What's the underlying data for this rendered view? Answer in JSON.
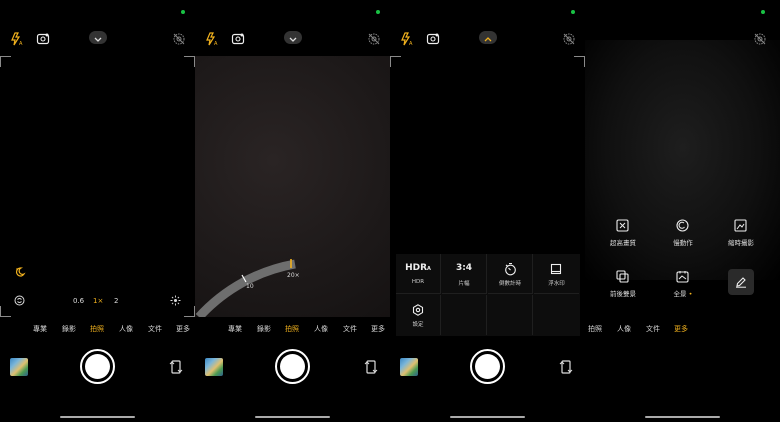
{
  "modes": {
    "pro": "專業",
    "video": "錄影",
    "photo": "拍照",
    "portrait": "人像",
    "document": "文件",
    "more": "更多"
  },
  "zoom": {
    "levels": [
      "0.6",
      "1×",
      "2"
    ],
    "dial_tick_10": "10",
    "dial_tick_20": "20×"
  },
  "quick_settings": [
    {
      "label": "HDR",
      "icon_text": "HDR",
      "icon_sub": "A"
    },
    {
      "label": "片幅",
      "icon_text": "3:4"
    },
    {
      "label": "倒數計時",
      "icon": "timer-icon"
    },
    {
      "label": "浮水印",
      "icon": "watermark-icon"
    },
    {
      "label": "設定",
      "icon": "settings-icon"
    }
  ],
  "more_modes": [
    {
      "label": "超高畫質",
      "icon": "ultra-hd-icon"
    },
    {
      "label": "慢動作",
      "icon": "slow-motion-icon"
    },
    {
      "label": "縮時攝影",
      "icon": "time-lapse-icon"
    },
    {
      "label": "前後雙景",
      "icon": "dual-view-icon"
    },
    {
      "label": "全景",
      "icon": "panorama-icon",
      "badge": "•"
    }
  ],
  "colors": {
    "accent": "#f2b21e",
    "status_dot": "#19c244"
  }
}
